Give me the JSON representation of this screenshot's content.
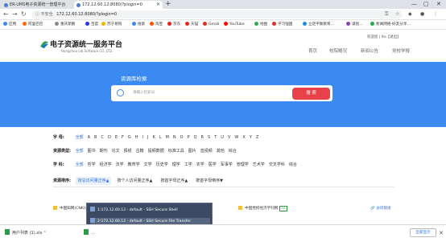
{
  "browser": {
    "tabs": [
      {
        "label": "ER-UMS电子资源统一管理平台",
        "favicon_color": "#4a7bd0",
        "active": false
      },
      {
        "label": "172.12.60.12:8080/?plogin=0",
        "favicon_color": "#4a7bd0",
        "active": true
      }
    ],
    "new_tab": "+",
    "window_controls": {
      "minimize": "—",
      "maximize": "▢",
      "close": "✕"
    },
    "nav": {
      "back": "←",
      "forward": "→",
      "reload": "↻"
    },
    "security_label": "不安全",
    "url": "172.12.60.12:8080/?plogin=0",
    "bookmarks": [
      {
        "label": "应用",
        "color": "#4285f4"
      },
      {
        "label": "阿里巴巴",
        "color": "#ff6a00"
      },
      {
        "label": "重庆新鹏",
        "color": "#888888"
      },
      {
        "label": "百度",
        "color": "#2932e1"
      },
      {
        "label": "苏宁易购",
        "color": "#f6b500"
      },
      {
        "label": "搜索",
        "color": "#3b8af2"
      },
      {
        "label": "淘宝",
        "color": "#ff5000"
      },
      {
        "label": "京东",
        "color": "#e1251b"
      },
      {
        "label": "天猫",
        "color": "#e1251b"
      },
      {
        "label": "Gmail",
        "color": "#d93025"
      },
      {
        "label": "YouTube",
        "color": "#ff0000"
      },
      {
        "label": "地图",
        "color": "#34a853"
      },
      {
        "label": "学习强国",
        "color": "#d32f2f"
      },
      {
        "label": "立足平衡教育…",
        "color": "#1e88e5"
      },
      {
        "label": "谋划…",
        "color": "#8e44ad"
      },
      {
        "label": "新闻网络-好友分享…",
        "color": "#2aa84a"
      }
    ]
  },
  "site": {
    "logo_text": "电子资源统一服务平台",
    "logo_subtext": "Hangzhou Lib Software CO.,LTD.",
    "user_text": "欢迎您 | lte【退出】",
    "nav": [
      "首页",
      "校院概况",
      "新闻公告",
      "党校学报"
    ],
    "banner_title": "资源库检索",
    "search_placeholder": "请输入检索词",
    "search_button": "搜 索"
  },
  "filters": {
    "letter": {
      "label": "字 母:",
      "items": [
        "全部",
        "A",
        "B",
        "C",
        "D",
        "E",
        "F",
        "G",
        "H",
        "I",
        "J",
        "K",
        "L",
        "M",
        "N",
        "O",
        "P",
        "Q",
        "R",
        "S",
        "T",
        "U",
        "V",
        "W",
        "X",
        "Y",
        "Z"
      ],
      "selected": "全部"
    },
    "type": {
      "label": "资源类型:",
      "items": [
        "全部",
        "图书",
        "期刊",
        "论文",
        "报纸",
        "古籍",
        "提纲数据",
        "标准工具",
        "图片",
        "音视频",
        "其他",
        "综合"
      ],
      "selected": "全部"
    },
    "subject": {
      "label": "学 科:",
      "items": [
        "全部",
        "哲学",
        "经济学",
        "法学",
        "教育学",
        "文学",
        "历史学",
        "理学",
        "工学",
        "农学",
        "医学",
        "军事学",
        "管理学",
        "艺术学",
        "交叉学科",
        "综合"
      ],
      "selected": "全部"
    },
    "sort": {
      "label": "资源排序:",
      "items": [
        "按总访问量正序▲",
        "按个人访问量正序▲",
        "按首字母正序▲",
        "按首字母倒序▼"
      ],
      "selected": "按总访问量正序▲"
    }
  },
  "results": [
    {
      "title": "中国知网(CNKI)",
      "tag": ""
    },
    {
      "title": "中国党校经济学刊网",
      "tag": "OA"
    }
  ],
  "visit_link": "访问链接",
  "popup_items": [
    "1:172.12.60.12 - default - SSH Secure Shell",
    "2:172.12.60.12 - default - SSH Secure File Transfer",
    "3:172.12.60.12 - default - SSH Secure Shell"
  ],
  "downloads": {
    "items": [
      "用户列表 (1).xls",
      "…"
    ],
    "show_all": "全部显示",
    "close": "✕"
  },
  "colors": {
    "brand_blue": "#3b8af2",
    "search_red": "#e8414a",
    "link_blue": "#2f6fe5"
  }
}
